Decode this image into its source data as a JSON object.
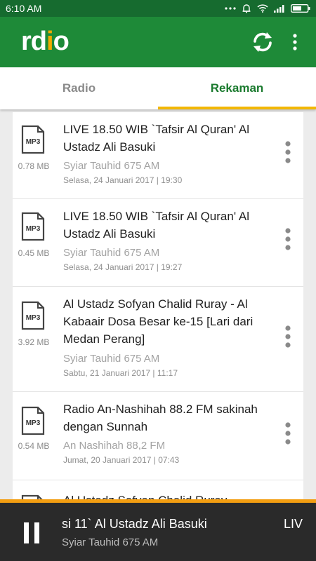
{
  "status_bar": {
    "time": "6:10 AM",
    "icons": [
      "ellipsis-icon",
      "alarm-icon",
      "wifi-icon",
      "signal-icon",
      "battery-icon"
    ]
  },
  "app": {
    "logo_main": "rd",
    "logo_accent": "i",
    "logo_end": "o",
    "actions": [
      "refresh-icon",
      "more-vert-icon"
    ]
  },
  "tabs": [
    {
      "label": "Radio",
      "active": false
    },
    {
      "label": "Rekaman",
      "active": true
    }
  ],
  "recordings": [
    {
      "title": "LIVE 18.50 WIB `Tafsir Al Quran' Al Ustadz Ali Basuki",
      "size": "0.78 MB",
      "source": "Syiar Tauhid 675 AM",
      "date": "Selasa, 24 Januari 2017 | 19:30"
    },
    {
      "title": "LIVE 18.50 WIB `Tafsir Al Quran' Al Ustadz Ali Basuki",
      "size": "0.45 MB",
      "source": "Syiar Tauhid 675 AM",
      "date": "Selasa, 24 Januari 2017 | 19:27"
    },
    {
      "title": "Al Ustadz Sofyan Chalid Ruray - Al Kabaair Dosa Besar ke-15 [Lari dari Medan Perang]",
      "size": "3.92 MB",
      "source": "Syiar Tauhid 675 AM",
      "date": "Sabtu, 21 Januari 2017 | 11:17"
    },
    {
      "title": "Radio An-Nashihah 88.2 FM sakinah dengan Sunnah",
      "size": "0.54 MB",
      "source": "An Nashihah 88,2 FM",
      "date": "Jumat, 20 Januari 2017 | 07:43"
    },
    {
      "title": "Al Ustadz Sofyan Chalid Ruray -",
      "size": "",
      "source": "",
      "date": ""
    }
  ],
  "file_type": "MP3",
  "player": {
    "title": "si 11` Al Ustadz Ali Basuki",
    "title_next": "LIV",
    "station": "Syiar Tauhid 675 AM",
    "accent_color": "#f29d11"
  },
  "colors": {
    "primary": "#1e8a38",
    "status_bar": "#166b2f",
    "tab_indicator": "#f2b705"
  }
}
